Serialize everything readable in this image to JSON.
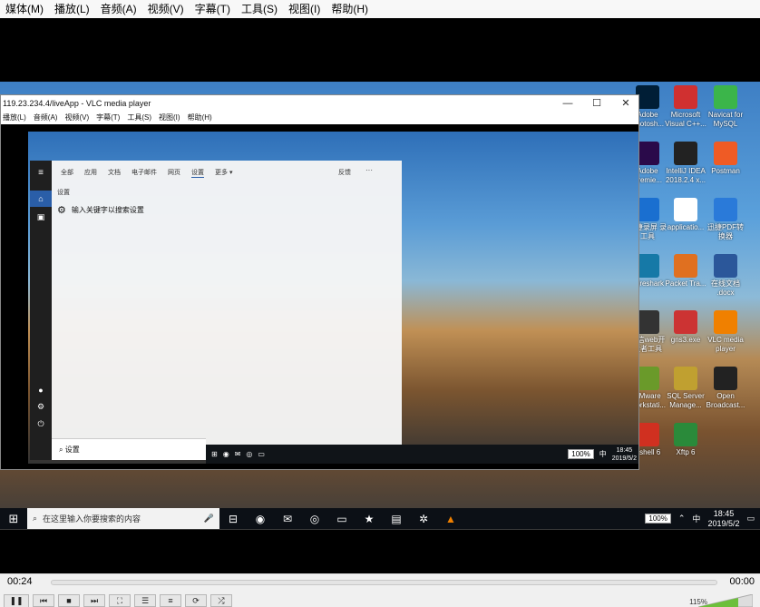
{
  "menu": [
    "媒体(M)",
    "播放(L)",
    "音频(A)",
    "视频(V)",
    "字幕(T)",
    "工具(S)",
    "视图(I)",
    "帮助(H)"
  ],
  "inner_window": {
    "title": "119.23.234.4/liveApp - VLC media player",
    "menu": [
      "播放(L)",
      "音频(A)",
      "视频(V)",
      "字幕(T)",
      "工具(S)",
      "视图(I)",
      "帮助(H)"
    ],
    "controls": [
      "—",
      "☐",
      "✕"
    ]
  },
  "search_panel": {
    "tabs": [
      "全部",
      "应用",
      "文档",
      "电子邮件",
      "网页",
      "设置",
      "更多 ▾"
    ],
    "feedback": "反馈",
    "header": "设置",
    "row_label": "输入关键字以搜索设置",
    "search_text": "设置"
  },
  "desktop_icons": [
    {
      "label": "Adobe Photosh...",
      "color": "#001e36"
    },
    {
      "label": "Microsoft Visual C++...",
      "color": "#d03030"
    },
    {
      "label": "Navicat for MySQL",
      "color": "#3bb54a"
    },
    {
      "label": "Adobe Premie...",
      "color": "#2a0a4a"
    },
    {
      "label": "IntelliJ IDEA 2018.2.4 x...",
      "color": "#222"
    },
    {
      "label": "Postman",
      "color": "#ef5b25"
    },
    {
      "label": "迅捷录屏 录工具",
      "color": "#1a6fd0"
    },
    {
      "label": "applicatio...",
      "color": "#ffffff"
    },
    {
      "label": "迅捷PDF转 换器",
      "color": "#2a7ad9"
    },
    {
      "label": "Wireshark",
      "color": "#1679a7"
    },
    {
      "label": "Packet Tra...",
      "color": "#e07020"
    },
    {
      "label": "在线文档 .docx",
      "color": "#2b579a"
    },
    {
      "label": "微信web开 发者工具",
      "color": "#333"
    },
    {
      "label": "gns3.exe",
      "color": "#cc3333"
    },
    {
      "label": "VLC media player",
      "color": "#f08000"
    },
    {
      "label": "VMware Workstati...",
      "color": "#6a9a2a"
    },
    {
      "label": "SQL Server Manage...",
      "color": "#c0a030"
    },
    {
      "label": "Open Broadcast...",
      "color": "#222"
    },
    {
      "label": "Xshell 6",
      "color": "#d03020"
    },
    {
      "label": "Xftp 6",
      "color": "#2a8a3a"
    }
  ],
  "taskbar": {
    "search_placeholder": "在这里输入你要搜索的内容",
    "battery": "100%",
    "ime": "中",
    "time": "18:45",
    "date": "2019/5/2"
  },
  "inner_taskbar": {
    "battery": "100%",
    "ime": "中",
    "time": "18:45",
    "date": "2019/5/2"
  },
  "playback": {
    "current_time": "00:24",
    "end_time": "00:00",
    "volume_label": "115%",
    "progress": 0
  }
}
